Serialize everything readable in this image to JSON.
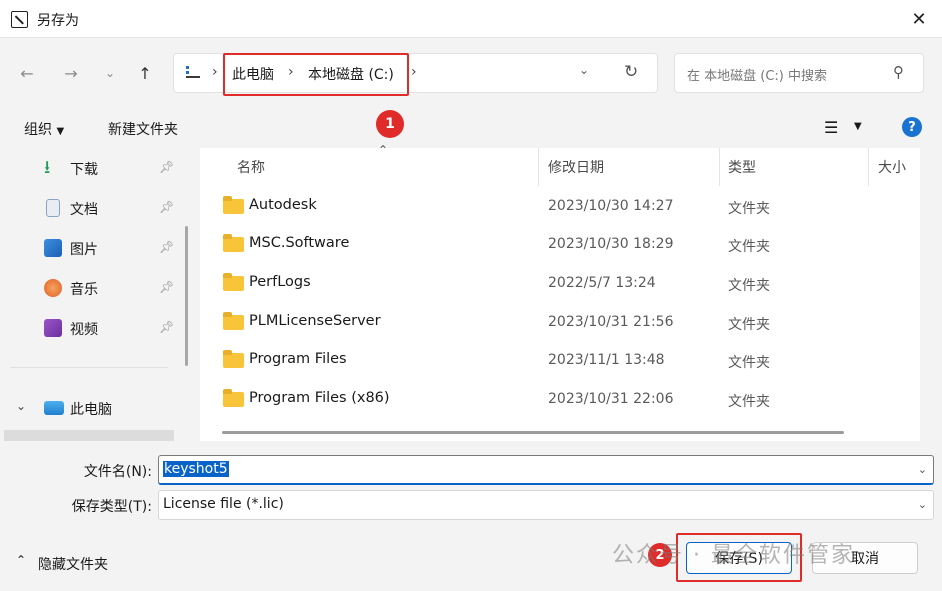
{
  "window": {
    "title": "另存为"
  },
  "address": {
    "crumbs": [
      "此电脑",
      "本地磁盘 (C:)"
    ],
    "search_placeholder": "在 本地磁盘 (C:) 中搜索"
  },
  "toolbar": {
    "organize": "组织",
    "new_folder": "新建文件夹"
  },
  "sidebar": {
    "quick_access": [
      {
        "label": "下载",
        "icon": "download-icon"
      },
      {
        "label": "文档",
        "icon": "document-icon"
      },
      {
        "label": "图片",
        "icon": "picture-icon"
      },
      {
        "label": "音乐",
        "icon": "music-icon"
      },
      {
        "label": "视频",
        "icon": "video-icon"
      }
    ],
    "this_pc": "此电脑"
  },
  "file_list": {
    "columns": [
      "名称",
      "修改日期",
      "类型",
      "大小"
    ],
    "rows": [
      {
        "name": "Autodesk",
        "modified": "2023/10/30 14:27",
        "type": "文件夹"
      },
      {
        "name": "MSC.Software",
        "modified": "2023/10/30 18:29",
        "type": "文件夹"
      },
      {
        "name": "PerfLogs",
        "modified": "2022/5/7 13:24",
        "type": "文件夹"
      },
      {
        "name": "PLMLicenseServer",
        "modified": "2023/10/31 21:56",
        "type": "文件夹"
      },
      {
        "name": "Program Files",
        "modified": "2023/11/1 13:48",
        "type": "文件夹"
      },
      {
        "name": "Program Files (x86)",
        "modified": "2023/10/31 22:06",
        "type": "文件夹"
      }
    ]
  },
  "form": {
    "filename_label": "文件名(N):",
    "filename_value": "keyshot5",
    "filetype_label": "保存类型(T):",
    "filetype_value": "License file (*.lic)"
  },
  "footer": {
    "hide_folders": "隐藏文件夹",
    "save": "保存(S)",
    "cancel": "取消"
  },
  "annotations": {
    "badge1": "1",
    "badge2": "2",
    "color": "#e02b2b"
  },
  "watermark": "公众号 · 最全软件管家"
}
